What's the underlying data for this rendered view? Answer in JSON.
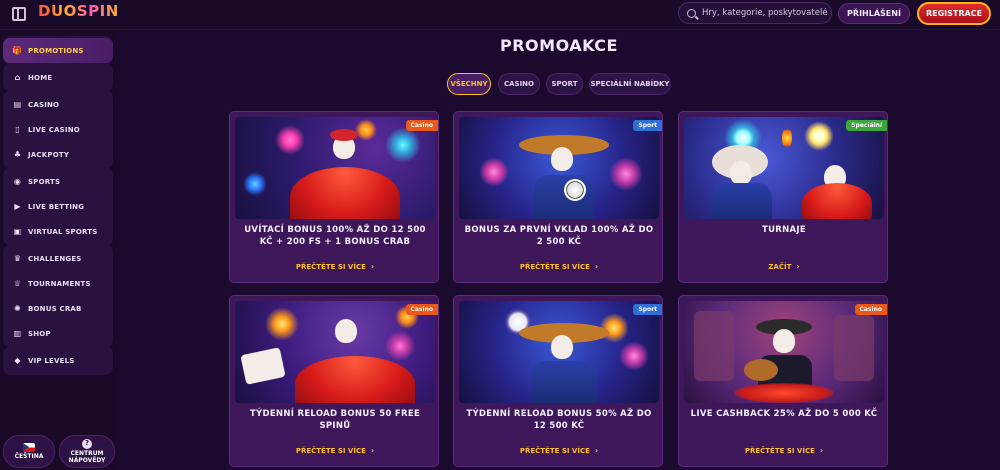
{
  "header": {
    "logo_text": "DUOSPIN",
    "search_placeholder": "Hry, kategorie, poskytovatelé",
    "login_label": "PŘIHLÁŠENÍ",
    "register_label": "REGISTRACE"
  },
  "sidebar": {
    "groups": [
      {
        "items": [
          {
            "label": "PROMOTIONS",
            "icon": "gift-icon",
            "active": true
          }
        ]
      },
      {
        "items": [
          {
            "label": "HOME",
            "icon": "home-icon"
          }
        ]
      },
      {
        "items": [
          {
            "label": "CASINO",
            "icon": "slot-machine-icon"
          },
          {
            "label": "LIVE CASINO",
            "icon": "cards-icon"
          },
          {
            "label": "JACKPOTY",
            "icon": "clover-icon"
          }
        ]
      },
      {
        "items": [
          {
            "label": "SPORTS",
            "icon": "ball-icon"
          },
          {
            "label": "LIVE BETTING",
            "icon": "play-icon"
          },
          {
            "label": "VIRTUAL SPORTS",
            "icon": "screen-icon"
          }
        ]
      },
      {
        "items": [
          {
            "label": "CHALLENGES",
            "icon": "trophy-icon"
          },
          {
            "label": "TOURNAMENTS",
            "icon": "cup-icon"
          },
          {
            "label": "BONUS CRAB",
            "icon": "crab-icon"
          },
          {
            "label": "SHOP",
            "icon": "bag-icon"
          }
        ]
      },
      {
        "items": [
          {
            "label": "VIP LEVELS",
            "icon": "diamond-icon"
          }
        ]
      }
    ],
    "language_label": "ČEŠTINA",
    "help_label_line1": "CENTRUM",
    "help_label_line2": "NÁPOVĚDY"
  },
  "main": {
    "title": "PROMOAKCE",
    "filters": [
      {
        "label": "VŠECHNY",
        "active": true
      },
      {
        "label": "CASINO"
      },
      {
        "label": "SPORT"
      },
      {
        "label": "SPECIÁLNÍ NABÍDKY"
      }
    ],
    "cards": [
      {
        "badge": "Casino",
        "badge_color": "#e8591a",
        "title": "UVÍTACÍ BONUS 100% AŽ DO 12 500 KČ + 200 FS + 1 BONUS CRAB",
        "link": "PŘEČTĚTE SI VÍCE"
      },
      {
        "badge": "Sport",
        "badge_color": "#2f6fd8",
        "title": "BONUS ZA PRVNÍ VKLAD 100% AŽ DO 2 500 KČ",
        "link": "PŘEČTĚTE SI VÍCE"
      },
      {
        "badge": "Speciální",
        "badge_color": "#3aa73a",
        "title": "TURNAJE",
        "link": "ZAČÍT"
      },
      {
        "badge": "Casino",
        "badge_color": "#e8591a",
        "title": "TÝDENNÍ RELOAD BONUS 50 FREE SPINŮ",
        "link": "PŘEČTĚTE SI VÍCE"
      },
      {
        "badge": "Sport",
        "badge_color": "#2f6fd8",
        "title": "TÝDENNÍ RELOAD BONUS 50% AŽ DO 12 500 KČ",
        "link": "PŘEČTĚTE SI VÍCE"
      },
      {
        "badge": "Casino",
        "badge_color": "#e8591a",
        "title": "LIVE CASHBACK 25% AŽ DO 5 000 KČ",
        "link": "PŘEČTĚTE SI VÍCE"
      }
    ]
  }
}
